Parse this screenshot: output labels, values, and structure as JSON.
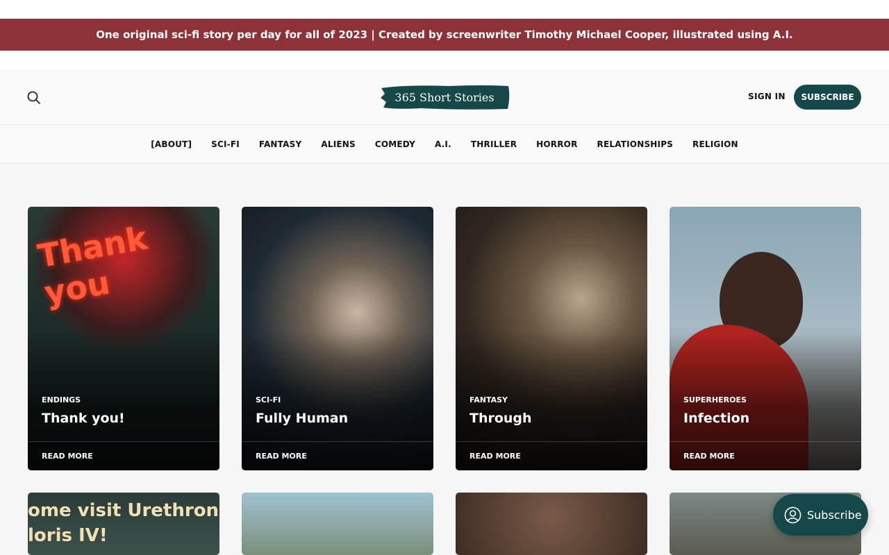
{
  "announcement": "One original sci-fi story per day for all of 2023 | Created by screenwriter Timothy Michael Cooper, illustrated using A.I.",
  "header": {
    "logo_text": "365 Short Stories",
    "sign_in": "SIGN IN",
    "subscribe": "SUBSCRIBE",
    "search_icon": "search-icon"
  },
  "nav": [
    {
      "label": "[ABOUT]"
    },
    {
      "label": "SCI-FI"
    },
    {
      "label": "FANTASY"
    },
    {
      "label": "ALIENS"
    },
    {
      "label": "COMEDY"
    },
    {
      "label": "A.I."
    },
    {
      "label": "THRILLER"
    },
    {
      "label": "HORROR"
    },
    {
      "label": "RELATIONSHIPS"
    },
    {
      "label": "RELIGION"
    }
  ],
  "cards": [
    {
      "tag": "ENDINGS",
      "title": "Thank you!",
      "read_more": "READ MORE",
      "image_text": "Thank you"
    },
    {
      "tag": "SCI-FI",
      "title": "Fully Human",
      "read_more": "READ MORE"
    },
    {
      "tag": "FANTASY",
      "title": "Through",
      "read_more": "READ MORE"
    },
    {
      "tag": "SUPERHEROES",
      "title": "Infection",
      "read_more": "READ MORE"
    }
  ],
  "second_row": {
    "poster_text_line1": "ome visit Urethron",
    "poster_text_line2": "loris IV!"
  },
  "floating_subscribe": "Subscribe",
  "colors": {
    "announcement_bg": "#8e323a",
    "brand": "#16484a"
  }
}
